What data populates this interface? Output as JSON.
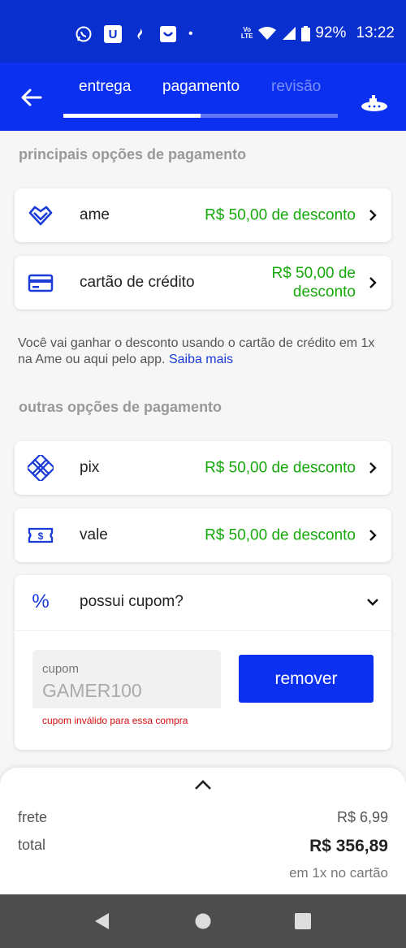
{
  "status_bar": {
    "apps": [
      "whatsapp-icon",
      "u-app-icon",
      "santander-icon",
      "smile-app-icon",
      "dot-icon"
    ],
    "u_letter": "U",
    "dot": "•",
    "volte": "Vo\nLTE",
    "battery": "92%",
    "time": "13:22"
  },
  "header": {
    "tabs": [
      "entrega",
      "pagamento",
      "revisão"
    ],
    "progress": 0.5,
    "accent": "#0c30f0"
  },
  "main_section_title": "principais opções de pagamento",
  "main_options": [
    {
      "icon": "ame-heart-icon",
      "label": "ame",
      "discount": "R$ 50,00 de desconto"
    },
    {
      "icon": "credit-card-icon",
      "label": "cartão de crédito",
      "discount_line1": "R$ 50,00 de",
      "discount_line2": "desconto"
    }
  ],
  "note": {
    "text": "Você vai ganhar o desconto usando o cartão de crédito em 1x na Ame ou aqui pelo app.",
    "link": "Saiba mais"
  },
  "other_section_title": "outras opções de pagamento",
  "other_options": [
    {
      "icon": "pix-icon",
      "label": "pix",
      "discount": "R$ 50,00 de desconto"
    },
    {
      "icon": "voucher-icon",
      "label": "vale",
      "discount": "R$ 50,00 de desconto"
    }
  ],
  "coupon": {
    "title": "possui cupom?",
    "field_label": "cupom",
    "field_value": "GAMER100",
    "error": "cupom inválido para essa compra",
    "button": "remover",
    "percent_symbol": "%"
  },
  "summary": {
    "shipping_label": "frete",
    "shipping_value": "R$ 6,99",
    "total_label": "total",
    "total_value": "R$ 356,89",
    "total_note": "em 1x no cartão"
  },
  "colors": {
    "discount": "#16a80c",
    "error": "#d10d0d"
  }
}
